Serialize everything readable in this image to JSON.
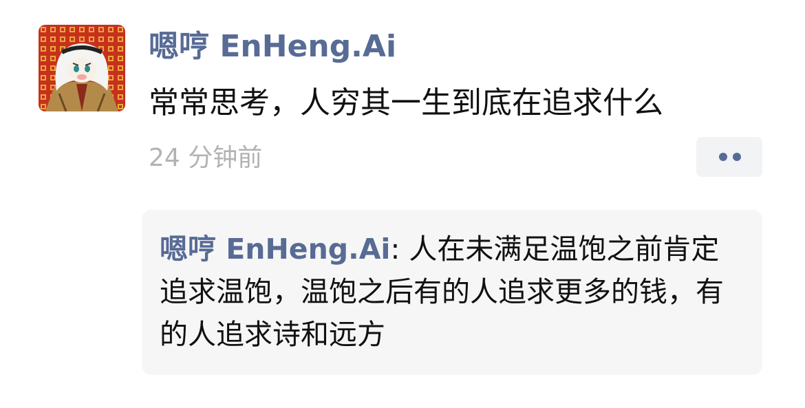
{
  "post": {
    "author": "嗯哼 EnHeng.Ai",
    "text": "常常思考，人穷其一生到底在追求什么",
    "timestamp": "24 分钟前",
    "avatar_icon": "avatar-keffiyeh-icon",
    "more_icon": "more-dots-icon"
  },
  "comments": [
    {
      "author": "嗯哼 EnHeng.Ai",
      "separator": ": ",
      "text": "人在未满足温饱之前肯定追求温饱，温饱之后有的人追求更多的钱，有的人追求诗和远方"
    }
  ],
  "colors": {
    "link": "#576b95",
    "text": "#111111",
    "muted": "#b2b2b2",
    "comment_bg": "#f6f6f6",
    "avatar_bg": "#c8301e"
  }
}
